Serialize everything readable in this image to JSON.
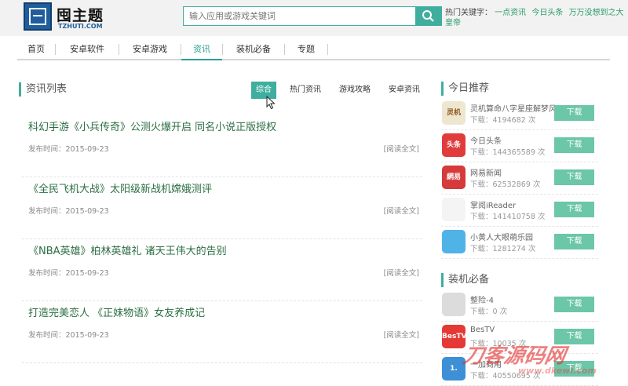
{
  "site": {
    "logo_text": "囤主题",
    "logo_sub": "TZHUTI.COM"
  },
  "search": {
    "placeholder": "输入应用或游戏关键词"
  },
  "hotkeys": {
    "label": "热门关键字：",
    "items": [
      "一点资讯",
      "今日头条",
      "万万没想到之大皇帝"
    ]
  },
  "nav": {
    "items": [
      "首页",
      "安卓软件",
      "安卓游戏",
      "资讯",
      "装机必备",
      "专题"
    ],
    "active": "资讯"
  },
  "news_section": {
    "title": "资讯列表",
    "filters": [
      "综合",
      "热门资讯",
      "游戏攻略",
      "安卓资讯"
    ],
    "active_filter": "综合"
  },
  "articles": [
    {
      "title": "科幻手游《小兵传奇》公测火爆开启 同名小说正版授权",
      "date": "发布时间：2015-09-23",
      "more": "[阅读全文]"
    },
    {
      "title": "《全民飞机大战》太阳级新战机嫦娥测评",
      "date": "发布时间：2015-09-23",
      "more": "[阅读全文]"
    },
    {
      "title": "《NBA英雄》柏林英雄礼 诸天王伟大的告别",
      "date": "发布时间：2015-09-23",
      "more": "[阅读全文]"
    },
    {
      "title": "打造完美恋人 《正妹物语》女友养成记",
      "date": "发布时间：2015-09-23",
      "more": "[阅读全文]"
    }
  ],
  "today": {
    "title": "今日推荐",
    "apps": [
      {
        "name": "灵机算命八字星座解梦风水",
        "downloads": "下载：4194682 次",
        "button": "下载",
        "icon_text": "灵机",
        "icon_bg": "#efe6cf",
        "icon_color": "#8a5a20"
      },
      {
        "name": "今日头条",
        "downloads": "下载：144365589 次",
        "button": "下载",
        "icon_text": "头条",
        "icon_bg": "#e03c3c",
        "icon_color": "#ffffff"
      },
      {
        "name": "网易新闻",
        "downloads": "下载：62532869 次",
        "button": "下载",
        "icon_text": "網易",
        "icon_bg": "#d63a3a",
        "icon_color": "#ffffff"
      },
      {
        "name": "掌阅iReader",
        "downloads": "下载：141410758 次",
        "button": "下载",
        "icon_text": "",
        "icon_bg": "#f4f4f4",
        "icon_color": "#333333"
      },
      {
        "name": "小黄人大眼萌乐园",
        "downloads": "下载：1281274 次",
        "button": "下载",
        "icon_text": "",
        "icon_bg": "#4fb3e8",
        "icon_color": "#333333"
      }
    ]
  },
  "essentials": {
    "title": "装机必备",
    "apps": [
      {
        "name": "整险-4",
        "downloads": "下载：0 次",
        "button": "下载",
        "icon_text": "",
        "icon_bg": "#dcdcdc",
        "icon_color": "#999999"
      },
      {
        "name": "BesTV",
        "downloads": "下载：10035 次",
        "button": "下载",
        "icon_text": "BesTV",
        "icon_bg": "#e53935",
        "icon_color": "#ffffff"
      },
      {
        "name": "一加商用",
        "downloads": "下载：40550695 次",
        "button": "下载",
        "icon_text": "1.",
        "icon_bg": "#3d8fd6",
        "icon_color": "#ffffff"
      }
    ]
  },
  "watermark": {
    "main": "刀客源码网",
    "sub": "www.dkewl.com"
  },
  "colors": {
    "accent": "#3fae9f",
    "link": "#2c6e43",
    "button": "#6cc6a8"
  }
}
